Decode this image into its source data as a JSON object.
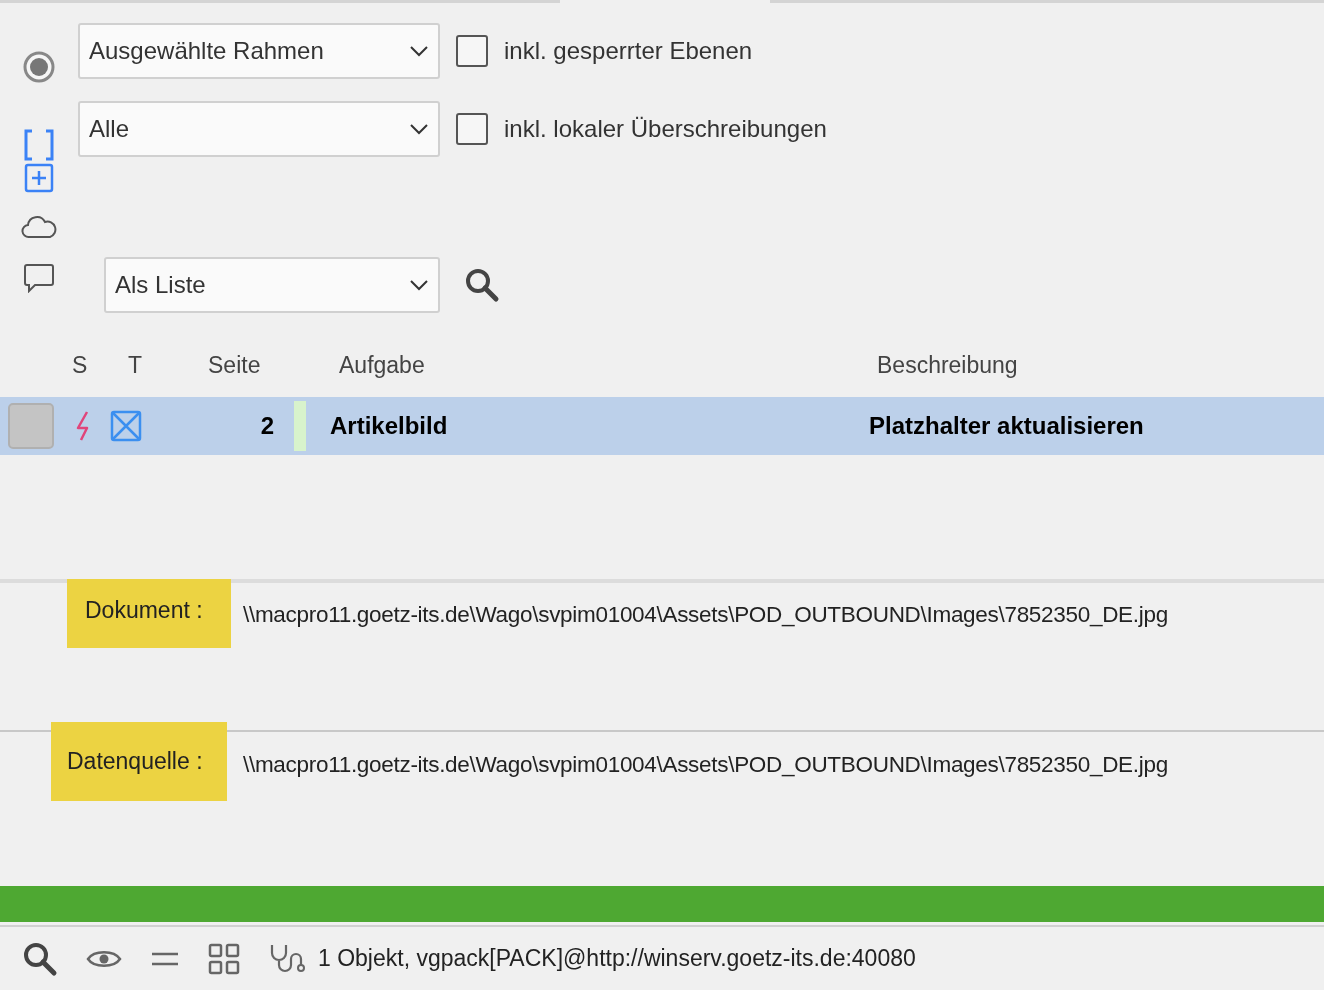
{
  "filters": [
    {
      "kind": "radio",
      "selected": true,
      "dropdown": "Ausgewählte Rahmen",
      "checkbox": {
        "label": "inkl. gesperrter Ebenen",
        "checked": false
      }
    },
    {
      "kind": "bracket",
      "dropdown": "Alle",
      "checkbox": {
        "label": "inkl. lokaler Überschreibungen",
        "checked": false
      }
    }
  ],
  "view_dropdown": "Als Liste",
  "table": {
    "columns": [
      "S",
      "T",
      "Seite",
      "Aufgabe",
      "Beschreibung"
    ],
    "rows": [
      {
        "selected": true,
        "page": "2",
        "task": "Artikelbild",
        "description": "Platzhalter aktualisieren"
      }
    ]
  },
  "details": [
    {
      "label": "Dokument :",
      "value": "\\\\macpro11.goetz-its.de\\Wago\\svpim01004\\Assets\\POD_OUTBOUND\\Images\\7852350_DE.jpg"
    },
    {
      "label": "Datenquelle :",
      "value": "\\\\macpro11.goetz-its.de\\Wago\\svpim01004\\Assets\\POD_OUTBOUND\\Images\\7852350_DE.jpg"
    }
  ],
  "progress": {
    "level": 1
  },
  "status_bar": {
    "text": "1 Objekt, vgpack[PACK]@http://winserv.goetz-its.de:40080"
  }
}
